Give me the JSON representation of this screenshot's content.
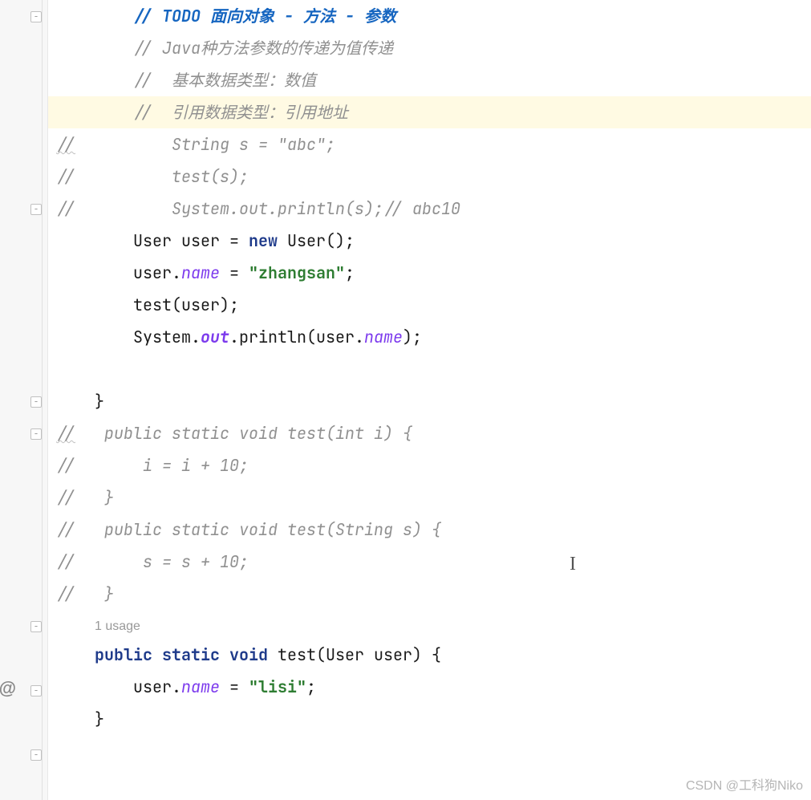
{
  "code": {
    "l01_todo": "// TODO 面向对象 - 方法 - 参数",
    "l02_cmt": "// Java种方法参数的传递为值传递",
    "l03_cmt": "//  基本数据类型：数值",
    "l04_cmt": "//  引用数据类型：引用地址",
    "l05_pre": "//",
    "l05_cmt": "  String s = \"abc\";",
    "l06_pre": "//",
    "l06_cmt": "  test(s);",
    "l07_pre": "//",
    "l07_cmt": "  System.out.println(s);// abc10",
    "l08_t1": "User user = ",
    "l08_kw": "new",
    "l08_t2": " User();",
    "l09_t1": "user.",
    "l09_f": "name",
    "l09_t2": " = ",
    "l09_s": "\"zhangsan\"",
    "l09_t3": ";",
    "l10": "test(user);",
    "l11_t1": "System.",
    "l11_f1": "out",
    "l11_t2": ".println(user.",
    "l11_f2": "name",
    "l11_t3": ");",
    "l13_brace": "}",
    "l14_pre": "//",
    "l14_cmt": "   public static void test(int i) {",
    "l15_pre": "//",
    "l15_cmt": "       i = i + 10;",
    "l16_pre": "//",
    "l16_cmt": "   }",
    "l17_pre": "//",
    "l17_cmt": "   public static void test(String s) {",
    "l18_pre": "//",
    "l18_cmt": "       s = s + 10;",
    "l19_pre": "//",
    "l19_cmt": "   }",
    "l20_usage": "1 usage",
    "l21_k1": "public",
    "l21_k2": "static",
    "l21_k3": "void",
    "l21_t": " test(User user) {",
    "l22_t1": "user.",
    "l22_f": "name",
    "l22_t2": " = ",
    "l22_s": "\"lisi\"",
    "l22_t3": ";",
    "l23_brace": "}"
  },
  "indent": {
    "i2": "        ",
    "i1": "    ",
    "sp": " "
  },
  "gutter": {
    "fold_minus": "−",
    "override": "@"
  },
  "cursor_glyph": "I",
  "watermark": "CSDN @工科狗Niko"
}
